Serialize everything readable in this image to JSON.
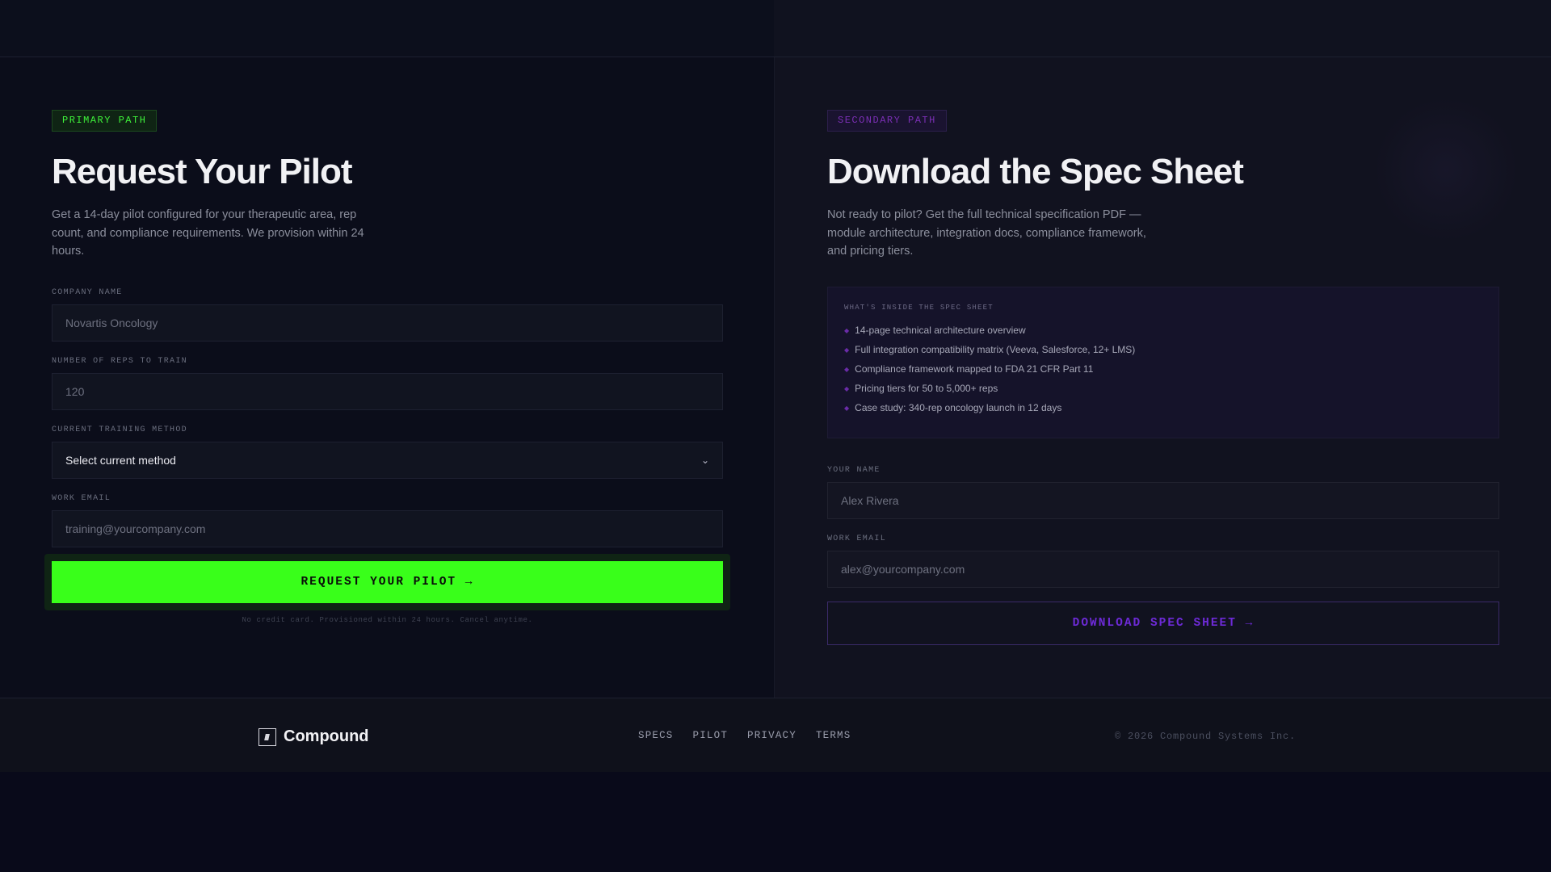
{
  "primary": {
    "tag": "PRIMARY PATH",
    "title": "Request Your Pilot",
    "description": "Get a 14-day pilot configured for your therapeutic area, rep count, and compliance requirements. We provision within 24 hours.",
    "fields": {
      "company": {
        "label": "COMPANY NAME",
        "placeholder": "Novartis Oncology"
      },
      "reps": {
        "label": "NUMBER OF REPS TO TRAIN",
        "placeholder": "120"
      },
      "method": {
        "label": "CURRENT TRAINING METHOD",
        "selected": "Select current method"
      },
      "email": {
        "label": "WORK EMAIL",
        "placeholder": "training@yourcompany.com"
      }
    },
    "submit_label": "REQUEST YOUR PILOT →",
    "fine_print": "No credit card. Provisioned within 24 hours. Cancel anytime."
  },
  "secondary": {
    "tag": "SECONDARY PATH",
    "title": "Download the Spec Sheet",
    "description": "Not ready to pilot? Get the full technical specification PDF — module architecture, integration docs, compliance framework, and pricing tiers.",
    "spec_box": {
      "title": "WHAT'S INSIDE THE SPEC SHEET",
      "items": [
        "14-page technical architecture overview",
        "Full integration compatibility matrix (Veeva, Salesforce, 12+ LMS)",
        "Compliance framework mapped to FDA 21 CFR Part 11",
        "Pricing tiers for 50 to 5,000+ reps",
        "Case study: 340-rep oncology launch in 12 days"
      ]
    },
    "fields": {
      "name": {
        "label": "YOUR NAME",
        "placeholder": "Alex Rivera"
      },
      "email": {
        "label": "WORK EMAIL",
        "placeholder": "alex@yourcompany.com"
      }
    },
    "submit_label": "DOWNLOAD SPEC SHEET →"
  },
  "footer": {
    "brand": "Compound",
    "nav": [
      "SPECS",
      "PILOT",
      "PRIVACY",
      "TERMS"
    ],
    "copyright": "© 2026 Compound Systems Inc."
  },
  "colors": {
    "accent_green": "#39ff1a",
    "accent_purple": "#6d2ad6",
    "background": "#090a1a"
  }
}
